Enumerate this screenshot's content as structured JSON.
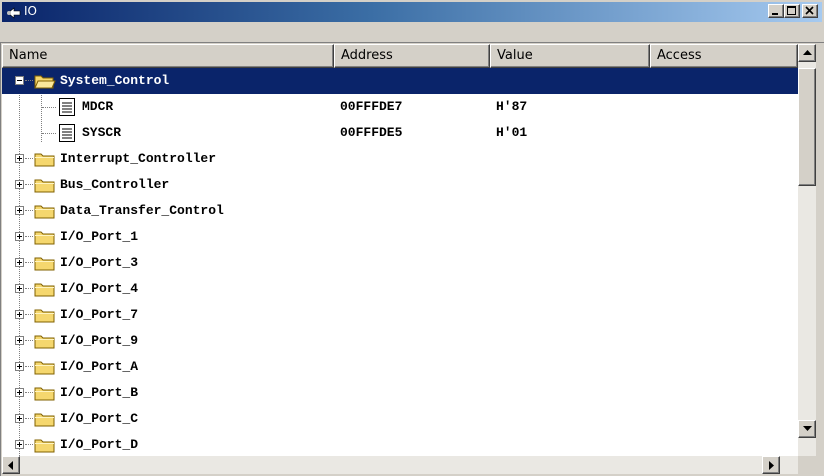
{
  "window": {
    "title": "IO",
    "title_icon": "io-window-icon",
    "controls": {
      "minimize": "minimize-icon",
      "maximize": "maximize-icon",
      "close": "close-icon"
    }
  },
  "columns": {
    "name": "Name",
    "address": "Address",
    "value": "Value",
    "access": "Access"
  },
  "rows": [
    {
      "name": "System_Control",
      "address": "",
      "value": "",
      "type": "folder",
      "expanded": true,
      "selected": true
    },
    {
      "name": "MDCR",
      "address": "00FFFDE7",
      "value": "H'87",
      "type": "register"
    },
    {
      "name": "SYSCR",
      "address": "00FFFDE5",
      "value": "H'01",
      "type": "register"
    },
    {
      "name": "Interrupt_Controller",
      "address": "",
      "value": "",
      "type": "folder",
      "expanded": false
    },
    {
      "name": "Bus_Controller",
      "address": "",
      "value": "",
      "type": "folder",
      "expanded": false
    },
    {
      "name": "Data_Transfer_Control",
      "address": "",
      "value": "",
      "type": "folder",
      "expanded": false
    },
    {
      "name": "I/O_Port_1",
      "address": "",
      "value": "",
      "type": "folder",
      "expanded": false
    },
    {
      "name": "I/O_Port_3",
      "address": "",
      "value": "",
      "type": "folder",
      "expanded": false
    },
    {
      "name": "I/O_Port_4",
      "address": "",
      "value": "",
      "type": "folder",
      "expanded": false
    },
    {
      "name": "I/O_Port_7",
      "address": "",
      "value": "",
      "type": "folder",
      "expanded": false
    },
    {
      "name": "I/O_Port_9",
      "address": "",
      "value": "",
      "type": "folder",
      "expanded": false
    },
    {
      "name": "I/O_Port_A",
      "address": "",
      "value": "",
      "type": "folder",
      "expanded": false
    },
    {
      "name": "I/O_Port_B",
      "address": "",
      "value": "",
      "type": "folder",
      "expanded": false
    },
    {
      "name": "I/O_Port_C",
      "address": "",
      "value": "",
      "type": "folder",
      "expanded": false
    },
    {
      "name": "I/O_Port_D",
      "address": "",
      "value": "",
      "type": "folder",
      "expanded": false
    }
  ],
  "colors": {
    "selection": "#0a246a",
    "titlebar_start": "#0a246a",
    "titlebar_end": "#a6caf0",
    "folder": "#f5d76e"
  }
}
